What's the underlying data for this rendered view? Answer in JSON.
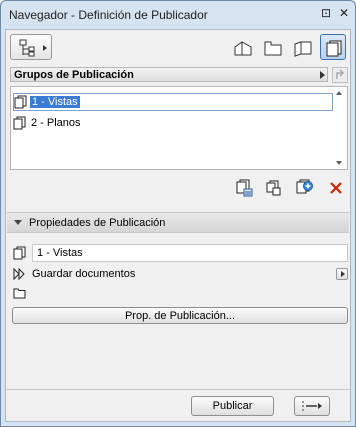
{
  "window": {
    "title": "Navegador - Definición de Publicador",
    "controls": {
      "pin": "⊡",
      "close": "✕"
    }
  },
  "toolbar": {
    "left_button_icon": "navigator-tree-icon",
    "view_icons": [
      "project-map-icon",
      "view-map-icon",
      "layout-book-icon",
      "publisher-sets-icon"
    ]
  },
  "groups": {
    "header_label": "Grupos de Publicación",
    "items": [
      {
        "label": "1 - Vistas",
        "selected": true
      },
      {
        "label": "2 - Planos",
        "selected": false
      }
    ]
  },
  "actions": {
    "icons": [
      "publisher-set-settings-icon",
      "duplicate-set-icon",
      "new-set-icon",
      "delete-icon"
    ],
    "delete_color": "#cc2200"
  },
  "properties": {
    "header_label": "Propiedades de Publicación",
    "name_value": "1 - Vistas",
    "mode_label": "Guardar documentos",
    "button_label": "Prop. de Publicación..."
  },
  "footer": {
    "publish_label": "Publicar"
  }
}
